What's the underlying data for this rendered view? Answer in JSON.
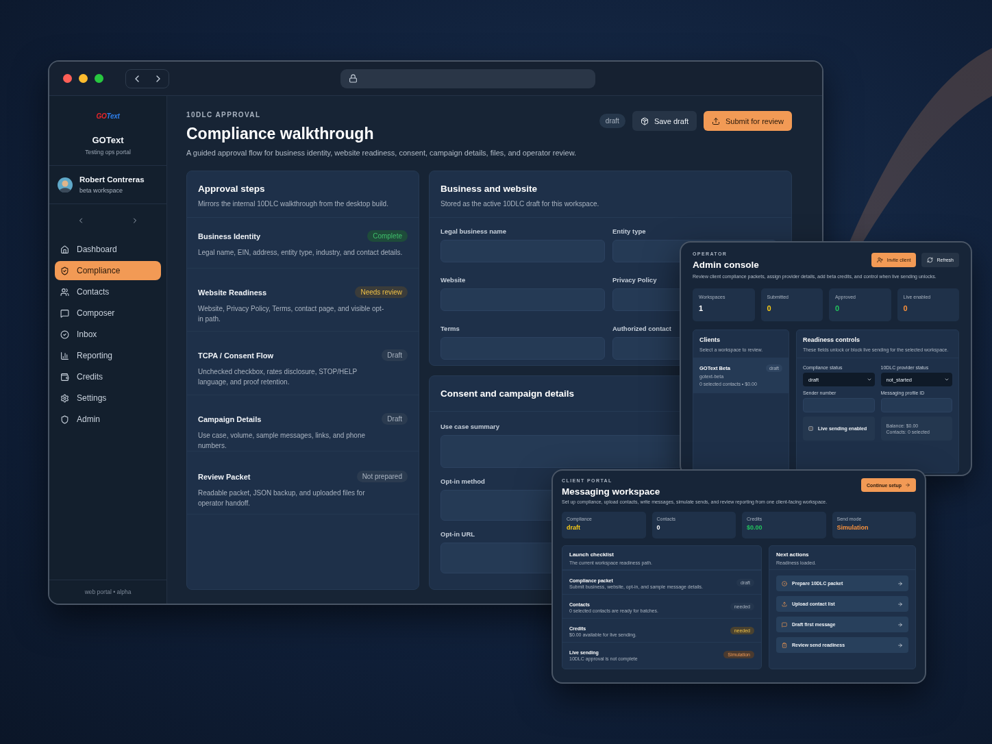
{
  "sidebar": {
    "logo": {
      "part_1": "GO",
      "part_2": "Text"
    },
    "brand": "GOText",
    "tagline": "Testing ops portal",
    "user": {
      "name": "Robert Contreras",
      "workspace": "beta workspace"
    },
    "nav": [
      {
        "label": "Dashboard",
        "selected": false
      },
      {
        "label": "Compliance",
        "selected": true
      },
      {
        "label": "Contacts",
        "selected": false
      },
      {
        "label": "Composer",
        "selected": false
      },
      {
        "label": "Inbox",
        "selected": false
      },
      {
        "label": "Reporting",
        "selected": false
      },
      {
        "label": "Credits",
        "selected": false
      },
      {
        "label": "Settings",
        "selected": false
      },
      {
        "label": "Admin",
        "selected": false
      }
    ],
    "footer": "web portal • alpha"
  },
  "header": {
    "eyebrow": "10DLC APPROVAL",
    "title": "Compliance walkthrough",
    "description": "A guided approval flow for business identity, website readiness, consent, campaign details, files, and operator review.",
    "status": "draft",
    "actions": [
      {
        "label": "Save draft",
        "kind": "secondary"
      },
      {
        "label": "Submit for review",
        "kind": "primary"
      }
    ]
  },
  "approval_steps": {
    "title": "Approval steps",
    "subtitle": "Mirrors the internal 10DLC walkthrough from the desktop build.",
    "steps": [
      {
        "title": "Business Identity",
        "description": "Legal name, EIN, address, entity type, industry, and contact details.",
        "status": "Complete",
        "kind": "success"
      },
      {
        "title": "Website Readiness",
        "description": "Website, Privacy Policy, Terms, contact page, and visible opt-in path.",
        "status": "Needs review",
        "kind": "warning"
      },
      {
        "title": "TCPA / Consent Flow",
        "description": "Unchecked checkbox, rates disclosure, STOP/HELP language, and proof retention.",
        "status": "Draft",
        "kind": "neutral"
      },
      {
        "title": "Campaign Details",
        "description": "Use case, volume, sample messages, links, and phone numbers.",
        "status": "Draft",
        "kind": "neutral"
      },
      {
        "title": "Review Packet",
        "description": "Readable packet, JSON backup, and uploaded files for operator handoff.",
        "status": "Not prepared",
        "kind": "neutral"
      }
    ]
  },
  "business_form": {
    "title": "Business and website",
    "subtitle": "Stored as the active 10DLC draft for this workspace.",
    "fields": [
      {
        "label": "Legal business name"
      },
      {
        "label": "Entity type"
      },
      {
        "label": "Website"
      },
      {
        "label": "Privacy Policy"
      },
      {
        "label": "Terms"
      },
      {
        "label": "Authorized contact"
      }
    ]
  },
  "consent_form": {
    "title": "Consent and campaign details",
    "fields": [
      {
        "label": "Use case summary",
        "kind": "textarea"
      },
      {
        "label": "Opt-in method",
        "kind": "textarea"
      },
      {
        "label": "Opt-in URL",
        "kind": "textarea"
      }
    ]
  },
  "admin_console": {
    "eyebrow": "OPERATOR",
    "title": "Admin console",
    "description": "Review client compliance packets, assign provider details, add beta credits, and control when live sending unlocks.",
    "actions": [
      {
        "label": "Invite client",
        "kind": "primary"
      },
      {
        "label": "Refresh",
        "kind": "secondary"
      }
    ],
    "stats": [
      {
        "label": "Workspaces",
        "value": "1",
        "color": "#ffffff"
      },
      {
        "label": "Submitted",
        "value": "0",
        "color": "#facc15"
      },
      {
        "label": "Approved",
        "value": "0",
        "color": "#22c55e"
      },
      {
        "label": "Live enabled",
        "value": "0",
        "color": "#fb923c"
      }
    ],
    "clients": {
      "title": "Clients",
      "subtitle": "Select a workspace to review.",
      "items": [
        {
          "name": "GOText Beta",
          "slug": "gotext-beta",
          "meta": "0 selected contacts • $0.00",
          "status": "draft",
          "selected": true
        }
      ]
    },
    "readiness": {
      "title": "Readiness controls",
      "subtitle": "These fields unlock or block live sending for the selected workspace.",
      "selects": [
        {
          "label": "Compliance status",
          "value": "draft"
        },
        {
          "label": "10DLC provider status",
          "value": "not_started"
        }
      ],
      "inputs": [
        {
          "label": "Sender number"
        },
        {
          "label": "Messaging profile ID"
        }
      ],
      "toggle": {
        "label": "Live sending enabled",
        "checked": false
      },
      "summary": [
        "Balance: $0.00",
        "Contacts: 0 selected"
      ]
    }
  },
  "client_portal": {
    "eyebrow": "CLIENT PORTAL",
    "title": "Messaging workspace",
    "description": "Set up compliance, upload contacts, write messages, simulate sends, and review reporting from one client-facing workspace.",
    "action": "Continue setup",
    "stats": [
      {
        "label": "Compliance",
        "value": "draft",
        "color": "#facc15"
      },
      {
        "label": "Contacts",
        "value": "0",
        "color": "#ffffff"
      },
      {
        "label": "Credits",
        "value": "$0.00",
        "color": "#22c55e"
      },
      {
        "label": "Send mode",
        "value": "Simulation",
        "color": "#fb923c"
      }
    ],
    "checklist": {
      "title": "Launch checklist",
      "subtitle": "The current workspace readiness path.",
      "items": [
        {
          "title": "Compliance packet",
          "description": "Submit business, website, opt-in, and sample message details.",
          "status": "draft",
          "kind": "neutral"
        },
        {
          "title": "Contacts",
          "description": "0 selected contacts are ready for batches.",
          "status": "needed",
          "kind": "neutral"
        },
        {
          "title": "Credits",
          "description": "$0.00 available for live sending.",
          "status": "needed",
          "kind": "warning"
        },
        {
          "title": "Live sending",
          "description": "10DLC approval is not complete",
          "status": "Simulation",
          "kind": "accent"
        }
      ]
    },
    "next_actions": {
      "title": "Next actions",
      "subtitle": "Readiness loaded.",
      "items": [
        {
          "label": "Prepare 10DLC packet"
        },
        {
          "label": "Upload contact list"
        },
        {
          "label": "Draft first message"
        },
        {
          "label": "Review send readiness"
        }
      ]
    }
  }
}
